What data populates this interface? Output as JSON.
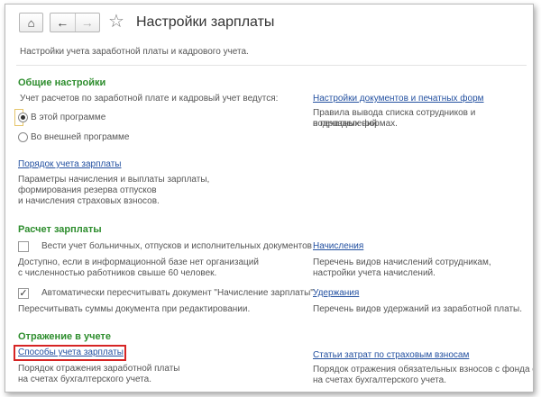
{
  "header": {
    "home_icon": "⌂",
    "back_icon": "←",
    "forward_icon": "→",
    "star_icon": "☆",
    "title": "Настройки зарплаты"
  },
  "subtitle": "Настройки учета заработной платы и кадрового учета.",
  "general": {
    "heading": "Общие настройки",
    "prompt": "Учет расчетов по заработной плате и кадровый учет ведутся:",
    "option1": "В этой программе",
    "option2": "Во внешней программе",
    "selected": "option1",
    "docs_link": "Настройки документов и печатных форм",
    "docs_desc_1": "Правила вывода списка сотрудников и подразделений",
    "docs_desc_2": "в печатных формах.",
    "order_link": "Порядок учета зарплаты",
    "order_desc_1": "Параметры начисления и выплаты зарплаты,",
    "order_desc_2": "формирования резерва отпусков",
    "order_desc_3": "и начисления страховых взносов."
  },
  "payroll": {
    "heading": "Расчет зарплаты",
    "sick_label": "Вести учет больничных, отпусков и исполнительных документов",
    "sick_checked": false,
    "sick_desc_1": "Доступно, если в информационной базе нет организаций",
    "sick_desc_2": "с численностью работников свыше 60 человек.",
    "accruals_link": "Начисления",
    "accruals_desc_1": "Перечень видов начислений сотрудникам,",
    "accruals_desc_2": "настройки учета начислений.",
    "auto_label": "Автоматически пересчитывать документ \"Начисление зарплаты\"",
    "auto_checked": true,
    "auto_desc": "Пересчитывать суммы документа при редактировании.",
    "deductions_link": "Удержания",
    "deductions_desc": "Перечень видов удержаний из заработной платы."
  },
  "accounting": {
    "heading": "Отражение в учете",
    "methods_link": "Способы учета зарплаты",
    "methods_desc_1": "Порядок отражения заработной платы",
    "methods_desc_2": "на счетах бухгалтерского учета.",
    "costs_link": "Статьи затрат по страховым взносам",
    "costs_desc_1": "Порядок отражения обязательных взносов с фонда опл",
    "costs_desc_2": "на счетах бухгалтерского учета.",
    "highlight_color": "#d62424"
  },
  "colors": {
    "section_heading": "#2d8d2d",
    "link": "#2350a0"
  }
}
